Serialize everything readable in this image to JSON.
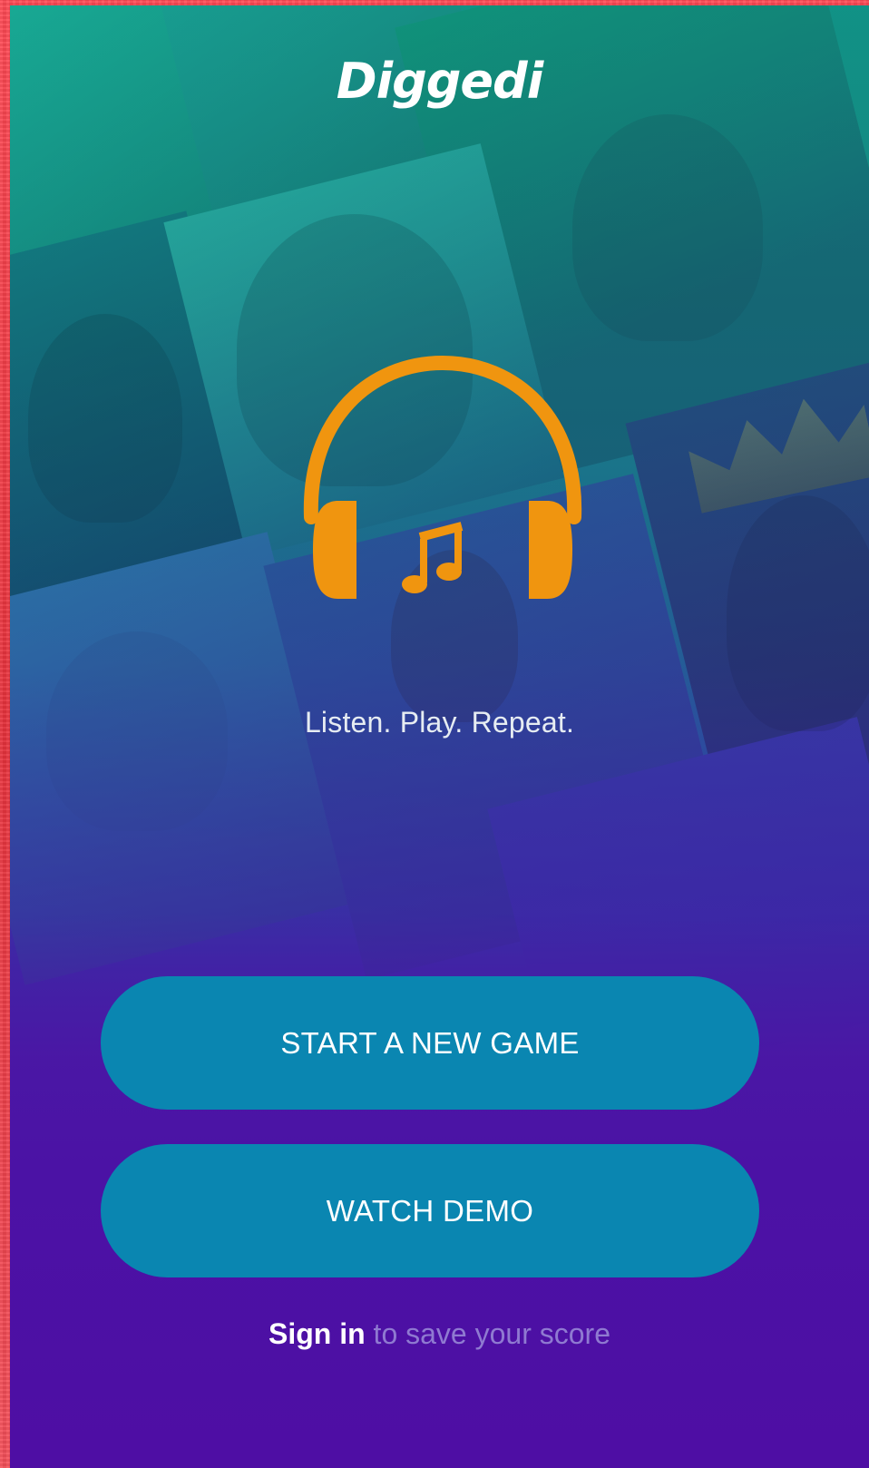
{
  "app": {
    "logo_text": "Diggedi",
    "tagline": "Listen. Play. Repeat."
  },
  "actions": {
    "start_label": "START A NEW GAME",
    "demo_label": "WATCH DEMO"
  },
  "signin": {
    "link_label": "Sign in",
    "rest_text": "to save your score"
  },
  "icons": {
    "hero": "headphones-music-note-icon"
  },
  "colors": {
    "accent_orange": "#f0950f",
    "button_blue": "#0a86b1",
    "bg_top": "#0f8a82",
    "bg_bottom": "#4e0ea4",
    "frame_red": "#ec3b46"
  }
}
